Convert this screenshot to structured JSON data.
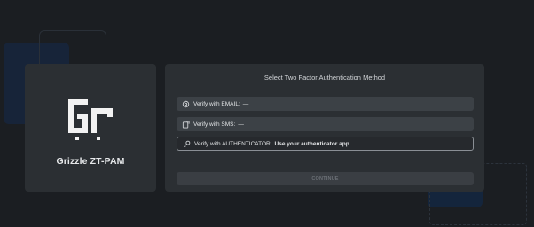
{
  "brand": {
    "name": "Grizzle ZT-PAM"
  },
  "panel": {
    "title": "Select Two Factor Authentication Method",
    "options": [
      {
        "label": "Verify with EMAIL:",
        "value": "—",
        "icon": "email-icon",
        "selected": false
      },
      {
        "label": "Verify with SMS:",
        "value": "—",
        "icon": "sms-icon",
        "selected": false
      },
      {
        "label": "Verify with AUTHENTICATOR:",
        "value": "Use your authenticator app",
        "icon": "key-icon",
        "selected": true
      }
    ],
    "continue_label": "CONTINUE"
  },
  "colors": {
    "background": "#1b1e22",
    "card": "#2b2f33",
    "option": "#3c4146",
    "accent_blue": "#16263d"
  }
}
